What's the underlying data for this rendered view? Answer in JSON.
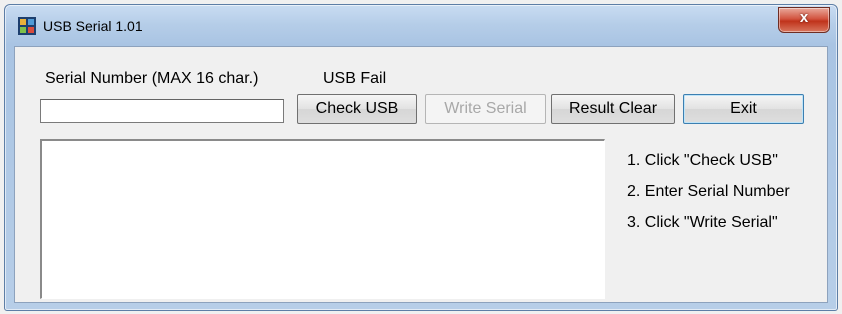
{
  "window": {
    "title": "USB Serial 1.01",
    "close_label": "x"
  },
  "serial": {
    "label": "Serial Number (MAX 16 char.)",
    "value": ""
  },
  "status": {
    "text": "USB Fail"
  },
  "buttons": {
    "check_usb": "Check USB",
    "write_serial": "Write Serial",
    "result_clear": "Result Clear",
    "exit": "Exit"
  },
  "result": {
    "text": ""
  },
  "instructions": [
    "1. Click \"Check USB\"",
    "2. Enter Serial Number",
    "3. Click \"Write Serial\""
  ],
  "colors": {
    "title_bar": "#b5cde8",
    "close_button": "#c0331b",
    "disabled_text": "#a8a8a8"
  }
}
